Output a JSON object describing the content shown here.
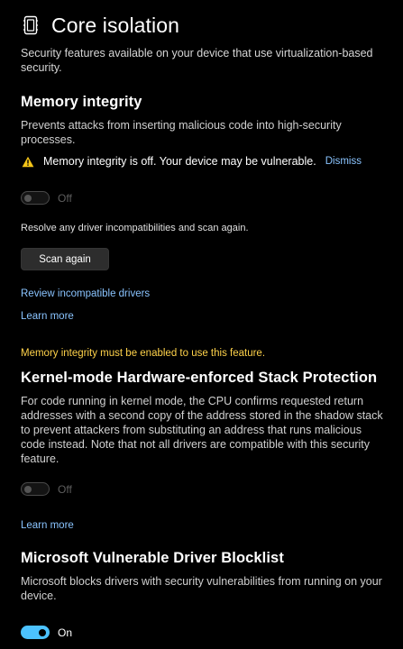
{
  "header": {
    "title": "Core isolation",
    "icon": "core-isolation-chip-icon"
  },
  "intro": "Security features available on your device that use virtualization-based security.",
  "memory_integrity": {
    "title": "Memory integrity",
    "description": "Prevents attacks from inserting malicious code into high-security processes.",
    "warning_icon": "warning-icon",
    "warning_text": "Memory integrity is off. Your device may be vulnerable.",
    "dismiss_label": "Dismiss",
    "toggle_state": "off",
    "toggle_label": "Off",
    "resolve_text": "Resolve any driver incompatibilities and scan again.",
    "scan_button_label": "Scan again",
    "review_link": "Review incompatible drivers",
    "learn_more": "Learn more"
  },
  "stack_protection": {
    "notice": "Memory integrity must be enabled to use this feature.",
    "title": "Kernel-mode Hardware-enforced Stack Protection",
    "description": "For code running in kernel mode, the CPU confirms requested return addresses with a second copy of the address stored in the shadow stack to prevent attackers from substituting an address that runs malicious code instead. Note that not all drivers are compatible with this security feature.",
    "toggle_state": "off",
    "toggle_label": "Off",
    "learn_more": "Learn more"
  },
  "driver_blocklist": {
    "title": "Microsoft Vulnerable Driver Blocklist",
    "description": "Microsoft blocks drivers with security vulnerabilities from running on your device.",
    "toggle_state": "on",
    "toggle_label": "On"
  },
  "colors": {
    "background": "#000000",
    "link": "#8ac4ff",
    "notice": "#ffd24a",
    "toggle_on": "#4cc2ff",
    "warning": "#f5c518"
  }
}
